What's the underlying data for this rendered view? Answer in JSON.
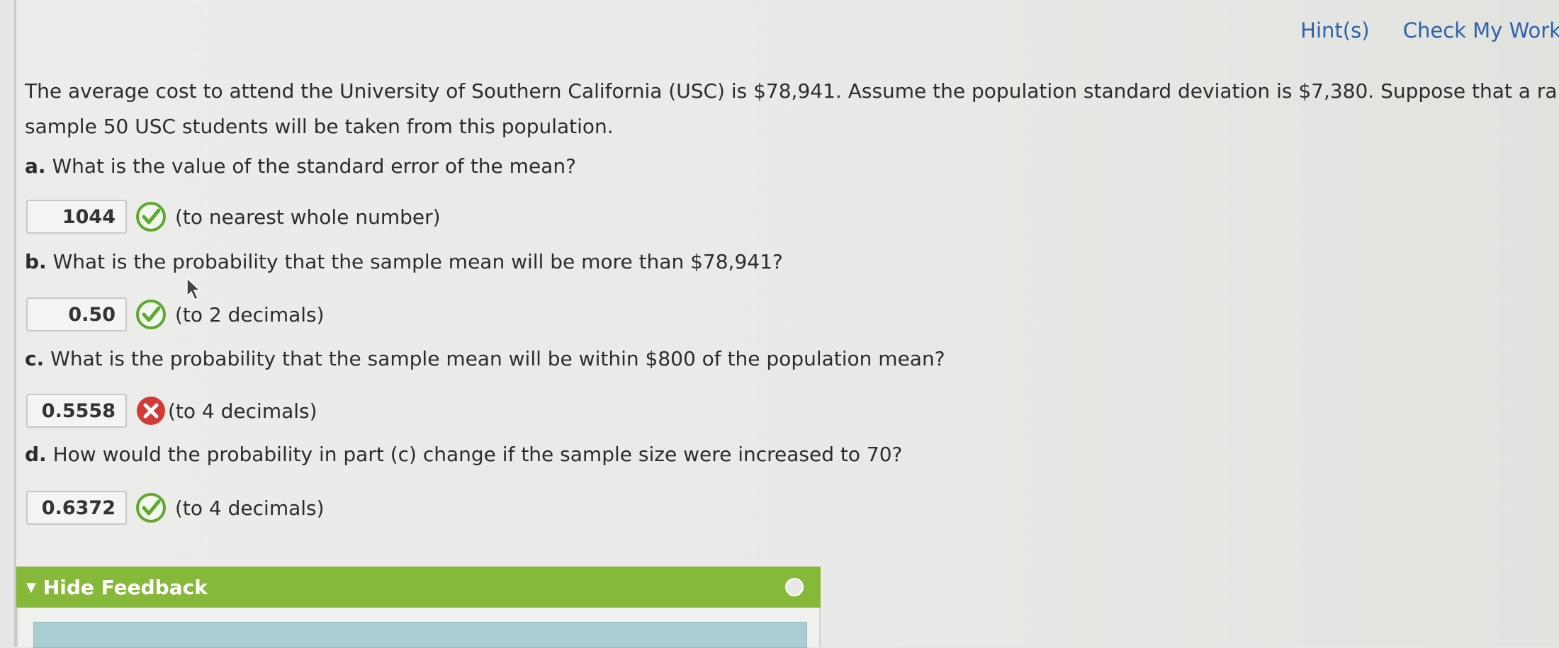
{
  "toolbar": {
    "hints": "Hint(s)",
    "check": "Check My Work"
  },
  "question": {
    "line1": "The average cost to attend the University of Southern California (USC) is $78,941. Assume the population standard deviation is $7,380. Suppose that a rando",
    "line2": "sample 50 USC students will be taken from this population."
  },
  "parts": [
    {
      "label": "a.",
      "text": "What is the value of the standard error of the mean?",
      "answer": "1044",
      "status": "correct",
      "hint": "(to nearest whole number)"
    },
    {
      "label": "b.",
      "text": "What is the probability that the sample mean will be more than $78,941?",
      "answer": "0.50",
      "status": "correct",
      "hint": "(to 2 decimals)"
    },
    {
      "label": "c.",
      "text": "What is the probability that the sample mean will be within $800 of the population mean?",
      "answer": "0.5558",
      "status": "incorrect",
      "hint": "(to 4 decimals)"
    },
    {
      "label": "d.",
      "text": "How would the probability in part (c) change if the sample size were increased to 70?",
      "answer": "0.6372",
      "status": "correct",
      "hint": "(to 4 decimals)"
    }
  ],
  "feedback": {
    "toggle_label": "Hide Feedback"
  },
  "colors": {
    "correct": "#5fa82e",
    "incorrect": "#d43a35",
    "link": "#2f62a8",
    "feedback_bar": "#86b83a"
  }
}
